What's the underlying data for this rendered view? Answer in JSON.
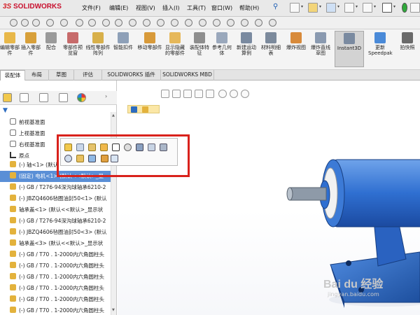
{
  "app": {
    "logo_ds": "3S",
    "logo_text": "SOLIDWORKS"
  },
  "menu": [
    "文件(F)",
    "编辑(E)",
    "视图(V)",
    "插入(I)",
    "工具(T)",
    "窗口(W)",
    "帮助(H)"
  ],
  "ribbon": [
    {
      "label": "编辑零部件",
      "icon": "edit-component-icon",
      "color": "#e8b84a"
    },
    {
      "label": "插入零部件",
      "icon": "insert-component-icon",
      "color": "#d8a03a"
    },
    {
      "label": "配合",
      "icon": "mate-icon",
      "color": "#9a9a9a"
    },
    {
      "label": "零部件预览窗",
      "icon": "component-preview-icon",
      "color": "#c76b6b"
    },
    {
      "label": "线性零部件阵列",
      "icon": "linear-pattern-icon",
      "color": "#d8b04a"
    },
    {
      "label": "智能扣件",
      "icon": "smart-fastener-icon",
      "color": "#8ea0b8"
    },
    {
      "label": "移动零部件",
      "icon": "move-component-icon",
      "color": "#d89a3a"
    },
    {
      "label": "显示隐藏的零部件",
      "icon": "show-hidden-icon",
      "color": "#e6b85a"
    },
    {
      "label": "装配体特征",
      "icon": "assembly-feature-icon",
      "color": "#8e8e8e"
    },
    {
      "label": "参考几何体",
      "icon": "reference-geometry-icon",
      "color": "#9aa8bc"
    },
    {
      "label": "新建运动算例",
      "icon": "motion-study-icon",
      "color": "#7a8aa0"
    },
    {
      "label": "材料明细表",
      "icon": "bom-icon",
      "color": "#7c8a9c"
    },
    {
      "label": "爆炸视图",
      "icon": "exploded-view-icon",
      "color": "#d88a3a"
    },
    {
      "label": "爆炸直线草图",
      "icon": "explode-line-sketch-icon",
      "color": "#8a9ab0"
    },
    {
      "label": "Instant3D",
      "icon": "instant3d-icon",
      "color": "#7a8aa0"
    },
    {
      "label": "更新Speedpak",
      "icon": "speedpak-icon",
      "color": "#4a8ad8"
    },
    {
      "label": "拍快照",
      "icon": "snapshot-icon",
      "color": "#6a6a6a"
    }
  ],
  "tabs": [
    "装配体",
    "布局",
    "草图",
    "评估",
    "SOLIDWORKS 插件",
    "SOLIDWORKS MBD"
  ],
  "tree": {
    "items": [
      {
        "label": "前视基准面",
        "icon": "plane-icon",
        "selected": false
      },
      {
        "label": "上视基准面",
        "icon": "plane-icon",
        "selected": false
      },
      {
        "label": "右视基准面",
        "icon": "plane-icon",
        "selected": false
      },
      {
        "label": "原点",
        "icon": "origin-icon",
        "selected": false
      },
      {
        "label": "(-) 轴<1> (默认",
        "icon": "part-icon",
        "selected": false
      },
      {
        "label": "(固定) 电机<1> (默认<<默认>_显",
        "icon": "part-icon",
        "selected": true
      },
      {
        "label": "(-) GB / T276-94深沟球轴承6210-2",
        "icon": "part-icon",
        "selected": false
      },
      {
        "label": "(-) JBZQ4606毡圈油封50<1> (默认",
        "icon": "part-icon",
        "selected": false
      },
      {
        "label": "轴承盖<1> (默认<<默认>_显示状",
        "icon": "part-icon",
        "selected": false
      },
      {
        "label": "(-) GB / T276-94深沟球轴承6210-2",
        "icon": "part-icon",
        "selected": false
      },
      {
        "label": "(-) JBZQ4606毡圈油封50<3> (默认",
        "icon": "part-icon",
        "selected": false
      },
      {
        "label": "轴承盖<3> (默认<<默认>_显示状",
        "icon": "part-icon",
        "selected": false
      },
      {
        "label": "(-) GB / T70 . 1-2000内六角圆柱头",
        "icon": "part-icon",
        "selected": false
      },
      {
        "label": "(-) GB / T70 . 1-2000内六角圆柱头",
        "icon": "part-icon",
        "selected": false
      },
      {
        "label": "(-) GB / T70 . 1-2000内六角圆柱头",
        "icon": "part-icon",
        "selected": false
      },
      {
        "label": "(-) GB / T70 . 1-2000内六角圆柱头",
        "icon": "part-icon",
        "selected": false
      },
      {
        "label": "(-) GB / T70 . 1-2000内六角圆柱头",
        "icon": "part-icon",
        "selected": false
      },
      {
        "label": "(-) GB / T70 . 1-2000内六角圆柱头",
        "icon": "part-icon",
        "selected": false
      }
    ]
  },
  "colors": {
    "accent": "#d9221c",
    "selection": "#5a8fd6",
    "model_blue": "#2f6fd1"
  },
  "watermark": {
    "brand": "Bai du 经验",
    "url": "jingyan.baidu.com"
  }
}
